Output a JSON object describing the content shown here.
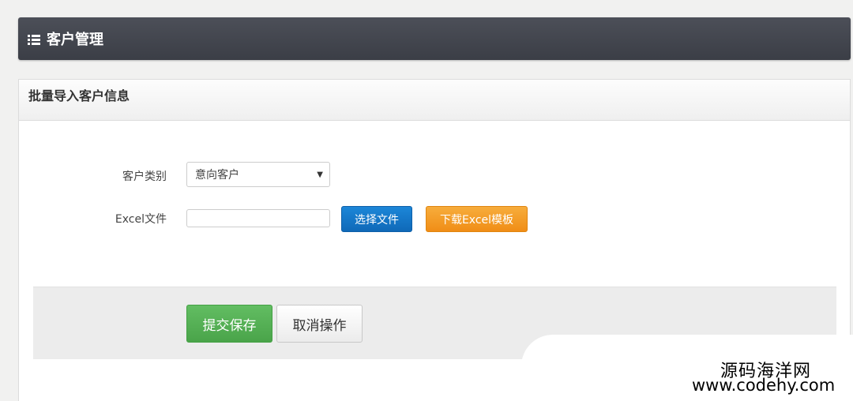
{
  "header": {
    "title": "客户管理",
    "icon": "list-icon"
  },
  "panel": {
    "title": "批量导入客户信息"
  },
  "form": {
    "category_label": "客户类别",
    "category_value": "意向客户",
    "file_label": "Excel文件",
    "file_value": "",
    "choose_file_label": "选择文件",
    "download_template_label": "下载Excel模板"
  },
  "actions": {
    "submit_label": "提交保存",
    "cancel_label": "取消操作"
  },
  "watermark": {
    "name": "源码海洋网",
    "url": "www.codehy.com"
  },
  "colors": {
    "header_bg": "#43464f",
    "primary_blue": "#1477c9",
    "warning_orange": "#f39c1f",
    "success_green": "#55b055"
  }
}
